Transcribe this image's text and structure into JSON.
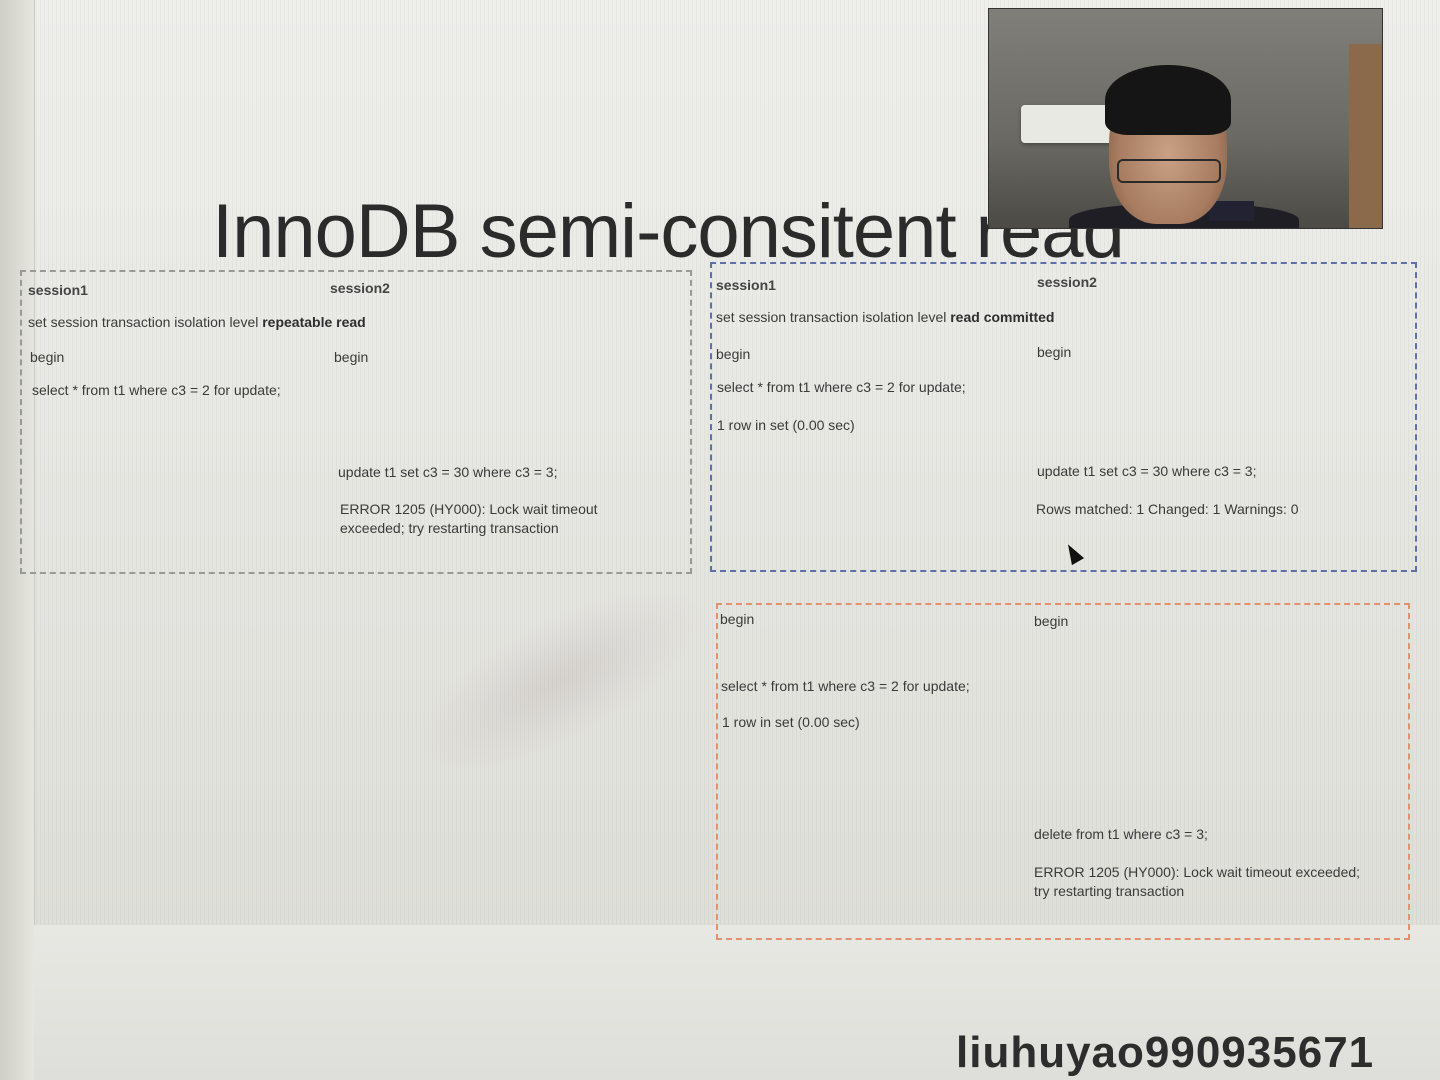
{
  "slide": {
    "title": "InnoDB semi-consitent read"
  },
  "panel_rr": {
    "session1_header": "session1",
    "session2_header": "session2",
    "isolation_prefix": "set session transaction isolation level ",
    "isolation_level": "repeatable read",
    "s1_begin": "begin",
    "s2_begin": "begin",
    "s1_select": "select * from t1 where c3 = 2 for update;",
    "s2_update": "update t1 set c3 = 30 where c3 = 3;",
    "s2_error": "ERROR 1205 (HY000): Lock wait timeout exceeded; try restarting transaction"
  },
  "panel_rc": {
    "session1_header": "session1",
    "session2_header": "session2",
    "isolation_prefix": "set session transaction isolation level ",
    "isolation_level": "read committed",
    "s1_begin": "begin",
    "s2_begin": "begin",
    "s1_select": "select * from t1 where c3 = 2 for update;",
    "s1_result": "1 row in set (0.00 sec)",
    "s2_update": "update t1 set c3 = 30 where c3 = 3;",
    "s2_result": "Rows matched: 1  Changed: 1  Warnings: 0"
  },
  "panel_rc_delete": {
    "s1_begin": "begin",
    "s2_begin": "begin",
    "s1_select": "select * from t1 where c3 = 2 for update;",
    "s1_result": "1 row in set (0.00 sec)",
    "s2_delete": "delete from t1 where c3 = 3;",
    "s2_error": "ERROR 1205 (HY000): Lock wait timeout exceeded; try restarting transaction"
  },
  "footer": {
    "username": "liuhuyao990935671"
  },
  "colors": {
    "panel_rr_border": "#9a9a94",
    "panel_rc_border": "#5f6fa8",
    "panel_delete_border": "#e3906f"
  }
}
